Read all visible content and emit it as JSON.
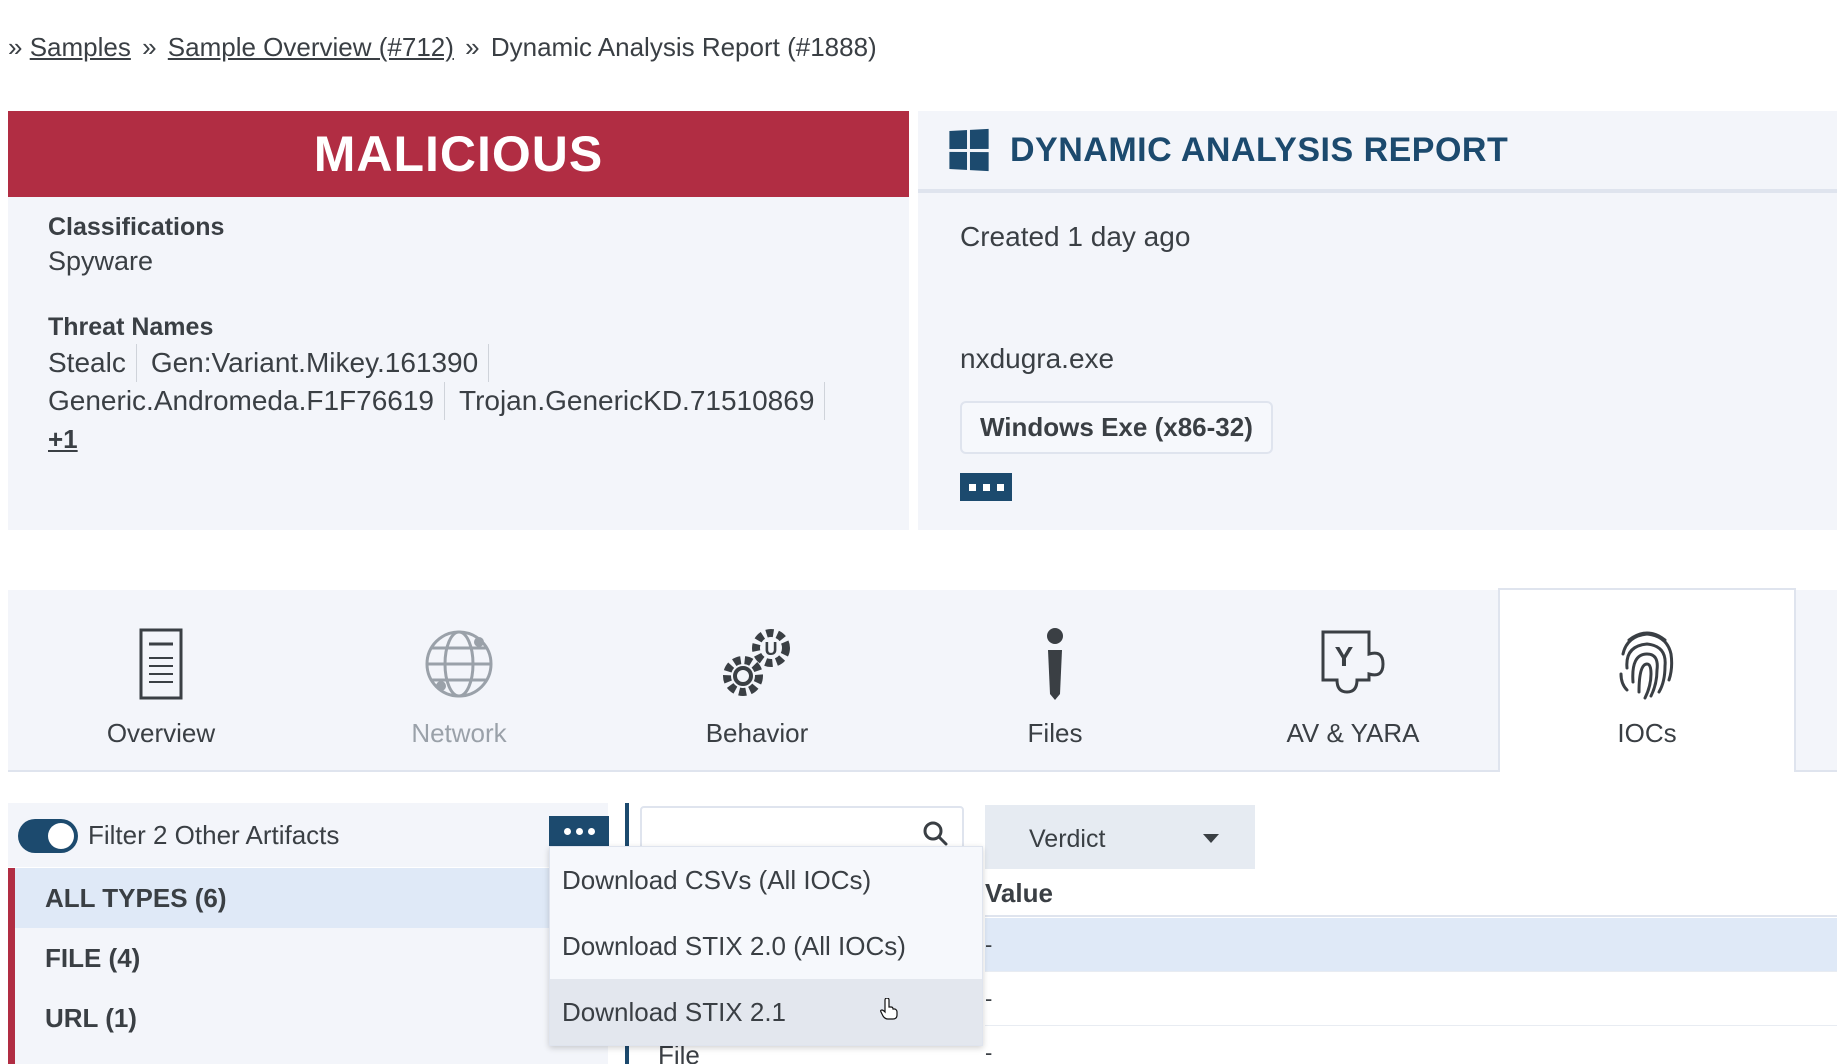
{
  "breadcrumb": {
    "prefix": "»",
    "items": [
      {
        "label": "Samples",
        "link": true
      },
      {
        "label": "Sample Overview (#712)",
        "link": true
      },
      {
        "label": "Dynamic Analysis Report (#1888)",
        "link": false
      }
    ],
    "separator": "»"
  },
  "verdict": {
    "label": "MALICIOUS",
    "color": "#b12d43",
    "classifications_label": "Classifications",
    "classifications_value": "Spyware",
    "threat_names_label": "Threat Names",
    "threat_names": [
      "Stealc",
      "Gen:Variant.Mikey.161390",
      "Generic.Andromeda.F1F76619",
      "Trojan.GenericKD.71510869"
    ],
    "more_label": "+1"
  },
  "report": {
    "title": "DYNAMIC ANALYSIS REPORT",
    "created": "Created 1 day ago",
    "filename": "nxdugra.exe",
    "filetype": "Windows Exe (x86-32)",
    "os_icon": "windows-icon",
    "accent": "#1c4a6e"
  },
  "tabs": [
    {
      "label": "Overview",
      "icon": "document-icon",
      "active": false,
      "disabled": false
    },
    {
      "label": "Network",
      "icon": "globe-icon",
      "active": false,
      "disabled": true
    },
    {
      "label": "Behavior",
      "icon": "gears-icon",
      "active": false,
      "disabled": false
    },
    {
      "label": "Files",
      "icon": "info-icon",
      "active": false,
      "disabled": false
    },
    {
      "label": "AV & YARA",
      "icon": "yara-icon",
      "active": false,
      "disabled": false
    },
    {
      "label": "IOCs",
      "icon": "fingerprint-icon",
      "active": true,
      "disabled": false
    }
  ],
  "iocs": {
    "filter_label": "Filter 2 Other Artifacts",
    "filter_enabled": true,
    "types": [
      {
        "label": "ALL TYPES (6)",
        "selected": true
      },
      {
        "label": "FILE (4)",
        "selected": false
      },
      {
        "label": "URL (1)",
        "selected": false
      }
    ],
    "search_placeholder": "",
    "verdict_select": "Verdict",
    "column_value": "Value",
    "rows": [
      "-",
      "-",
      "-"
    ],
    "partial_row_label": "File"
  },
  "dropdown": {
    "items": [
      {
        "label": "Download CSVs (All IOCs)",
        "hover": false
      },
      {
        "label": "Download STIX 2.0 (All IOCs)",
        "hover": false
      },
      {
        "label": "Download STIX 2.1",
        "hover": true
      }
    ]
  }
}
